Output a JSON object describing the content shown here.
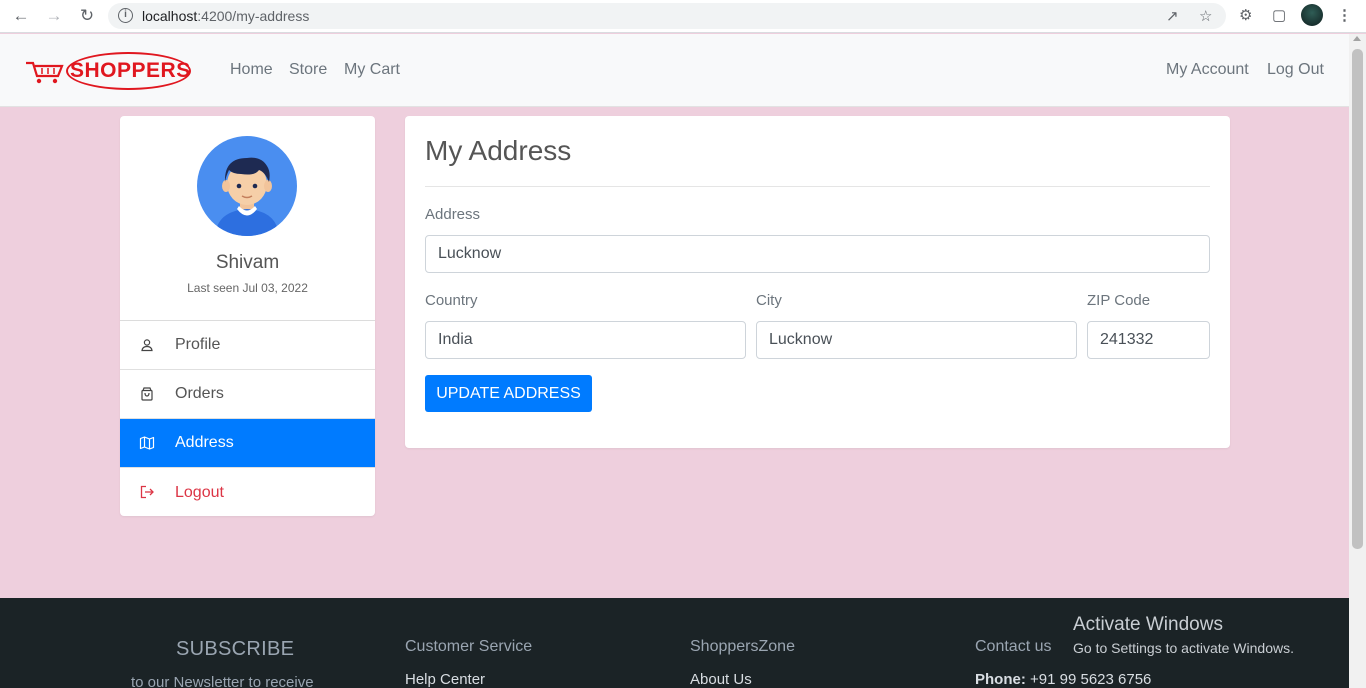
{
  "browser": {
    "url_host": "localhost",
    "url_path": ":4200/my-address"
  },
  "header": {
    "logo_text": "SHOPPERS",
    "nav": [
      {
        "label": "Home"
      },
      {
        "label": "Store"
      },
      {
        "label": "My Cart"
      }
    ],
    "account_label": "My Account",
    "logout_label": "Log Out"
  },
  "profile": {
    "name": "Shivam",
    "last_seen": "Last seen Jul 03, 2022",
    "menu": [
      {
        "label": "Profile",
        "icon": "user-icon"
      },
      {
        "label": "Orders",
        "icon": "shopping-bag-icon"
      },
      {
        "label": "Address",
        "icon": "map-icon",
        "active": true
      },
      {
        "label": "Logout",
        "icon": "logout-icon"
      }
    ]
  },
  "address_form": {
    "title": "My Address",
    "address_label": "Address",
    "address_value": "Lucknow",
    "country_label": "Country",
    "country_value": "India",
    "city_label": "City",
    "city_value": "Lucknow",
    "zip_label": "ZIP Code",
    "zip_value": "241332",
    "submit_label": "UPDATE ADDRESS"
  },
  "footer": {
    "subscribe_title": "SUBSCRIBE",
    "subscribe_text": "to our Newsletter to receive",
    "customer_service_title": "Customer Service",
    "customer_service_link": "Help Center",
    "zone_title": "ShoppersZone",
    "zone_link": "About Us",
    "contact_title": "Contact us",
    "phone_label": "Phone:",
    "phone_value": "+91 99 5623 6756"
  },
  "os_overlay": {
    "title": "Activate Windows",
    "subtitle": "Go to Settings to activate Windows."
  },
  "colors": {
    "page_bg": "#eecfdd",
    "accent": "#007bff",
    "logo_red": "#e0171f",
    "logout_red": "#dc3545",
    "footer_bg": "#1b2326"
  }
}
